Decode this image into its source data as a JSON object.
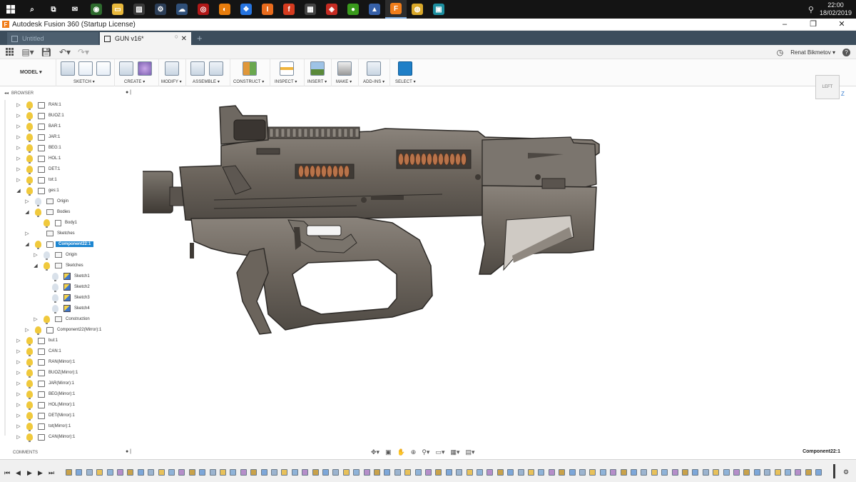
{
  "taskbar": {
    "apps": [
      {
        "icon": "search-icon",
        "glyph": "⌕",
        "color": "#141414"
      },
      {
        "icon": "task-view-icon",
        "glyph": "⧉",
        "color": "#141414"
      },
      {
        "icon": "mail-icon",
        "glyph": "✉",
        "color": "#141414"
      },
      {
        "icon": "app-green-icon",
        "glyph": "◉",
        "color": "#2e6b2e"
      },
      {
        "icon": "file-explorer-icon",
        "glyph": "▭",
        "color": "#e9b93c"
      },
      {
        "icon": "photos-icon",
        "glyph": "▨",
        "color": "#3a3a3a"
      },
      {
        "icon": "steam-icon",
        "glyph": "⚙",
        "color": "#2c3e57"
      },
      {
        "icon": "app-cloud-icon",
        "glyph": "☁",
        "color": "#2f4f78"
      },
      {
        "icon": "app-red-icon",
        "glyph": "◎",
        "color": "#b01818"
      },
      {
        "icon": "blender-icon",
        "glyph": "◐",
        "color": "#e87d0d"
      },
      {
        "icon": "dropbox-icon",
        "glyph": "❖",
        "color": "#2674e0"
      },
      {
        "icon": "app-orange-icon",
        "glyph": "I",
        "color": "#e96b1d"
      },
      {
        "icon": "app-red2-icon",
        "glyph": "f",
        "color": "#d63b1f"
      },
      {
        "icon": "calculator-icon",
        "glyph": "▦",
        "color": "#444444"
      },
      {
        "icon": "app-red3-icon",
        "glyph": "◈",
        "color": "#c62b22"
      },
      {
        "icon": "app-lime-icon",
        "glyph": "●",
        "color": "#3a9a1c"
      },
      {
        "icon": "app-blue-icon",
        "glyph": "▲",
        "color": "#3660a8"
      },
      {
        "icon": "fusion360-icon",
        "glyph": "F",
        "color": "#f07d1a",
        "active": true
      },
      {
        "icon": "chrome-icon",
        "glyph": "◍",
        "color": "#d9a82a"
      },
      {
        "icon": "app-monitor-icon",
        "glyph": "▣",
        "color": "#1d8fa0"
      }
    ],
    "time": "22:00",
    "date": "18/02/2019"
  },
  "window": {
    "title": "Autodesk Fusion 360 (Startup License)",
    "minimize": "–",
    "maximize": "❐",
    "close": "✕"
  },
  "tabs": [
    {
      "label": "Untitled",
      "active": false
    },
    {
      "label": "GUN v16*",
      "active": true
    }
  ],
  "app_header": {
    "user": "Renat Bikmetov ▾",
    "help": "?"
  },
  "toolbar": {
    "mode": "MODEL ▾",
    "groups": [
      {
        "label": "SKETCH ▾"
      },
      {
        "label": "CREATE ▾"
      },
      {
        "label": "MODIFY ▾"
      },
      {
        "label": "ASSEMBLE ▾"
      },
      {
        "label": "CONSTRUCT ▾"
      },
      {
        "label": "INSPECT ▾"
      },
      {
        "label": "INSERT ▾"
      },
      {
        "label": "MAKE ▾"
      },
      {
        "label": "ADD-INS ▾"
      },
      {
        "label": "SELECT ▾"
      }
    ]
  },
  "browser": {
    "title": "BROWSER",
    "items": [
      {
        "label": "RAN:1",
        "depth": 0,
        "expanded": false,
        "icon": "component"
      },
      {
        "label": "BUOZ:1",
        "depth": 0,
        "expanded": false,
        "icon": "component"
      },
      {
        "label": "BAR:1",
        "depth": 0,
        "expanded": false,
        "icon": "component"
      },
      {
        "label": "JAR:1",
        "depth": 0,
        "expanded": false,
        "icon": "component"
      },
      {
        "label": "BEG:1",
        "depth": 0,
        "expanded": false,
        "icon": "component"
      },
      {
        "label": "HOL:1",
        "depth": 0,
        "expanded": false,
        "icon": "component"
      },
      {
        "label": "DET:1",
        "depth": 0,
        "expanded": false,
        "icon": "component"
      },
      {
        "label": "tot:1",
        "depth": 0,
        "expanded": false,
        "icon": "component"
      },
      {
        "label": "ges:1",
        "depth": 0,
        "expanded": true,
        "icon": "component"
      },
      {
        "label": "Origin",
        "depth": 1,
        "expanded": false,
        "icon": "folder",
        "dim": true
      },
      {
        "label": "Bodies",
        "depth": 1,
        "expanded": true,
        "icon": "folder"
      },
      {
        "label": "Body1",
        "depth": 2,
        "expanded": null,
        "icon": "body"
      },
      {
        "label": "Sketches",
        "depth": 1,
        "expanded": false,
        "icon": "folder",
        "nobulb": true
      },
      {
        "label": "Component22:1",
        "depth": 1,
        "expanded": true,
        "icon": "component",
        "selected": true
      },
      {
        "label": "Origin",
        "depth": 2,
        "expanded": false,
        "icon": "folder",
        "dim": true
      },
      {
        "label": "Sketches",
        "depth": 2,
        "expanded": true,
        "icon": "folder"
      },
      {
        "label": "Sketch1",
        "depth": 3,
        "expanded": null,
        "icon": "sketch",
        "dim": true
      },
      {
        "label": "Sketch2",
        "depth": 3,
        "expanded": null,
        "icon": "sketch",
        "dim": true
      },
      {
        "label": "Sketch3",
        "depth": 3,
        "expanded": null,
        "icon": "sketch",
        "dim": true
      },
      {
        "label": "Sketch4",
        "depth": 3,
        "expanded": null,
        "icon": "sketch",
        "dim": true
      },
      {
        "label": "Construction",
        "depth": 2,
        "expanded": false,
        "icon": "folder"
      },
      {
        "label": "Component22(Mirror):1",
        "depth": 1,
        "expanded": false,
        "icon": "component"
      },
      {
        "label": "bul:1",
        "depth": 0,
        "expanded": false,
        "icon": "component"
      },
      {
        "label": "CAN:1",
        "depth": 0,
        "expanded": false,
        "icon": "component"
      },
      {
        "label": "RAN(Mirror):1",
        "depth": 0,
        "expanded": false,
        "icon": "component"
      },
      {
        "label": "BUOZ(Mirror):1",
        "depth": 0,
        "expanded": false,
        "icon": "component"
      },
      {
        "label": "JAR(Mirror):1",
        "depth": 0,
        "expanded": false,
        "icon": "component"
      },
      {
        "label": "BEG(Mirror):1",
        "depth": 0,
        "expanded": false,
        "icon": "component"
      },
      {
        "label": "HOL(Mirror):1",
        "depth": 0,
        "expanded": false,
        "icon": "component"
      },
      {
        "label": "DET(Mirror):1",
        "depth": 0,
        "expanded": false,
        "icon": "component"
      },
      {
        "label": "tot(Mirror):1",
        "depth": 0,
        "expanded": false,
        "icon": "component"
      },
      {
        "label": "CAN(Mirror):1",
        "depth": 0,
        "expanded": false,
        "icon": "component"
      }
    ]
  },
  "comments": {
    "title": "COMMENTS"
  },
  "viewcube": {
    "face": "LEFT",
    "axis": "Z"
  },
  "status": {
    "active_component": "Component22:1"
  },
  "colors": {
    "accent": "#1d86d1",
    "tab_bar": "#3c4d5c",
    "model_gray": "#6b645c",
    "model_dark": "#3f3a35",
    "bullet_copper": "#b8734a"
  }
}
